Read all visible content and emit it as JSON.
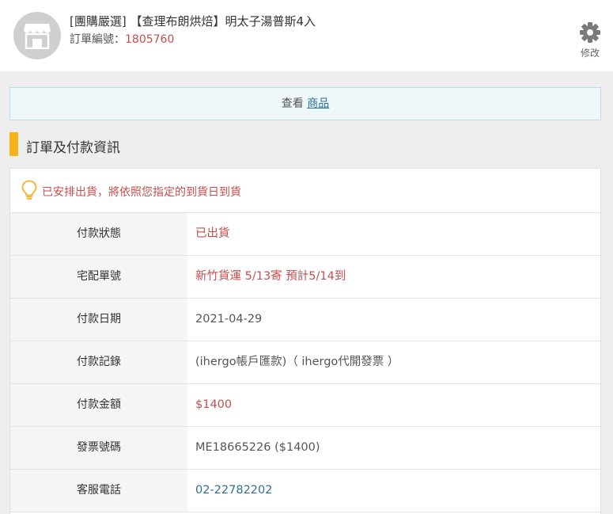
{
  "header": {
    "title": "[團購嚴選] 【查理布朗烘焙】明太子湯普斯4入",
    "order_label": "訂單編號：",
    "order_number": "1805760",
    "edit_label": "修改"
  },
  "view_bar": {
    "prefix": "查看 ",
    "link": "商品"
  },
  "section": {
    "title": "訂單及付款資訊"
  },
  "notice": {
    "text": "已安排出貨，將依照您指定的到貨日到貨"
  },
  "rows": [
    {
      "label": "付款狀態",
      "value": "已出貨"
    },
    {
      "label": "宅配單號",
      "value": "新竹貨運 5/13寄 預計5/14到"
    },
    {
      "label": "付款日期",
      "value": "2021-04-29"
    },
    {
      "label": "付款記錄",
      "value": "(ihergo帳戶匯款)（ ihergo代開發票 ）"
    },
    {
      "label": "付款金額",
      "value": "$1400"
    },
    {
      "label": "發票號碼",
      "value": "ME18665226 ($1400)"
    },
    {
      "label": "客服電話",
      "value": "02-22782202"
    }
  ],
  "colors": {
    "accent_red": "#c84e4e",
    "link_blue": "#2f6f96",
    "section_bar": "#f3b41b"
  },
  "icons": {
    "store": "store-icon",
    "edit": "gear-icon",
    "notice": "lightbulb-icon"
  }
}
